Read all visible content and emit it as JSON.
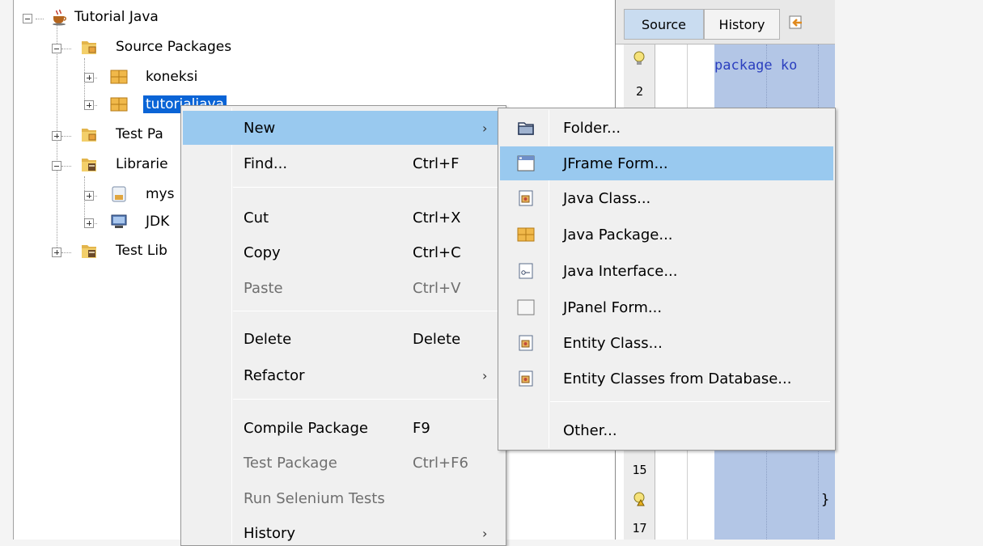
{
  "tree": {
    "project": "Tutorial Java",
    "source_packages": "Source Packages",
    "pkg_koneksi": "koneksi",
    "pkg_selected": "tutorialjava",
    "test_packages": "Test Pa",
    "libraries": "Librarie",
    "lib_mysql": "mys",
    "lib_jdk": "JDK",
    "test_libraries": "Test Lib"
  },
  "editor": {
    "tab_source": "Source",
    "tab_history": "History",
    "code_line": "package ko",
    "code_brace": "}",
    "line_numbers": [
      "2",
      "15",
      "17"
    ]
  },
  "context_menu": {
    "new": "New",
    "find": "Find...",
    "find_shortcut": "Ctrl+F",
    "cut": "Cut",
    "cut_shortcut": "Ctrl+X",
    "copy": "Copy",
    "copy_shortcut": "Ctrl+C",
    "paste": "Paste",
    "paste_shortcut": "Ctrl+V",
    "delete": "Delete",
    "delete_shortcut": "Delete",
    "refactor": "Refactor",
    "compile": "Compile Package",
    "compile_shortcut": "F9",
    "test": "Test Package",
    "test_shortcut": "Ctrl+F6",
    "selenium": "Run Selenium Tests",
    "history": "History"
  },
  "new_submenu": {
    "folder": "Folder...",
    "jframe": "JFrame Form...",
    "java_class": "Java Class...",
    "java_package": "Java Package...",
    "java_interface": "Java Interface...",
    "jpanel": "JPanel Form...",
    "entity_class": "Entity Class...",
    "entity_db": "Entity Classes from Database...",
    "other": "Other..."
  },
  "colors": {
    "menu_highlight": "#99c9ef",
    "selection": "#0a64d6",
    "code_background": "#b3c6e6",
    "keyword": "#2b3fbf"
  }
}
